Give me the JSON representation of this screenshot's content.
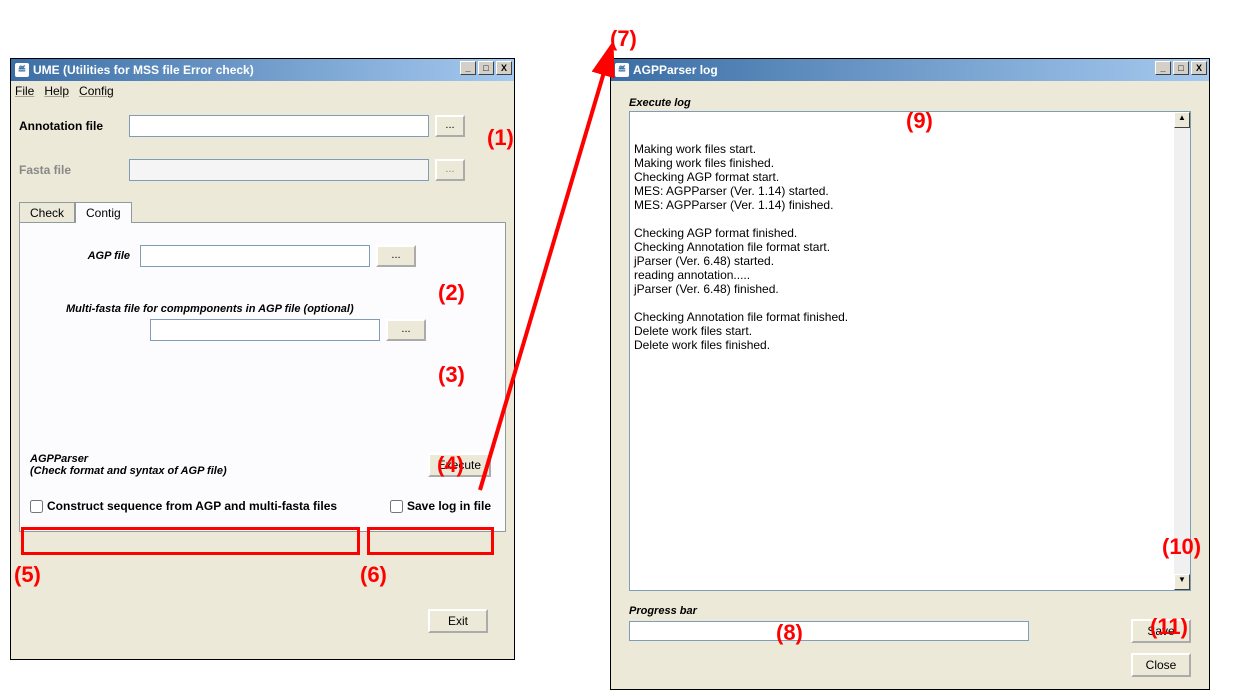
{
  "ume": {
    "title": "UME (Utilities for MSS file Error check)",
    "menu": {
      "file": "File",
      "help": "Help",
      "config": "Config"
    },
    "annotation_label": "Annotation file",
    "fasta_label": "Fasta  file",
    "browse": "...",
    "tabs": {
      "check": "Check",
      "contig": "Contig"
    },
    "agp_label": "AGP file",
    "multifasta_label": "Multi-fasta file for compmponents in AGP file (optional)",
    "agpparser_title": "AGPParser",
    "agpparser_sub": "(Check format and syntax of AGP file)",
    "execute": "Execute",
    "construct": "Construct sequence from AGP and multi-fasta files",
    "savelog": "Save log in file",
    "exit": "Exit"
  },
  "log": {
    "title": "AGPParser log",
    "execute_log_label": "Execute log",
    "content": "Making work files start.\nMaking work files finished.\nChecking AGP format start.\nMES: AGPParser (Ver. 1.14) started.\nMES: AGPParser (Ver. 1.14) finished.\n\nChecking AGP format finished.\nChecking Annotation file format start.\njParser (Ver. 6.48) started.\nreading annotation.....\njParser (Ver. 6.48) finished.\n\nChecking Annotation file format finished.\nDelete work files start.\nDelete work files finished.",
    "progress_label": "Progress bar",
    "save": "Save",
    "close": "Close"
  },
  "call": {
    "n1": "(1)",
    "n2": "(2)",
    "n3": "(3)",
    "n4": "(4)",
    "n5": "(5)",
    "n6": "(6)",
    "n7": "(7)",
    "n8": "(8)",
    "n9": "(9)",
    "n10": "(10)",
    "n11": "(11)"
  }
}
